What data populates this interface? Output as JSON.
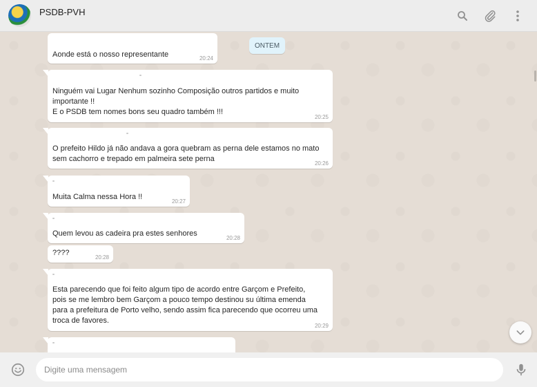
{
  "header": {
    "title": "PSDB-PVH",
    "icons": [
      "search-icon",
      "attach-icon",
      "menu-icon"
    ]
  },
  "chat": {
    "date_label": "ONTEM",
    "messages": [
      {
        "text": "Aonde está o nosso representante",
        "time": "20:24"
      },
      {
        "text": "Ninguém vai Lugar Nenhum sozinho Composição outros partidos e muito\nimportante !!\nE o PSDB tem nomes bons seu quadro também !!!",
        "time": "20:25"
      },
      {
        "text": "O prefeito Hildo já não andava a gora quebram as perna dele estamos no mato\nsem cachorro e trepado em palmeira sete perna",
        "time": "20:26"
      },
      {
        "text": "Muita Calma nessa Hora !!",
        "time": "20:27"
      },
      {
        "text": "Quem levou as cadeira pra estes senhores",
        "time": "20:28"
      },
      {
        "text": "????",
        "time": "20:28"
      },
      {
        "text": "Esta parecendo que foi feito algum tipo de acordo entre Garçom e Prefeito,\npois se me lembro bem Garçom a pouco tempo destinou su última emenda\npara a prefeitura de Porto velho, sendo assim fica parecendo que ocorreu uma\ntroca de favores.",
        "time": "20:29"
      }
    ]
  },
  "composer": {
    "placeholder": "Digite uma mensagem",
    "icons": [
      "emoji-icon",
      "microphone-icon"
    ]
  },
  "colors": {
    "background": "#e5ddd5",
    "header": "#ededed",
    "bubble": "#ffffff",
    "date_pill": "#e1f3fb",
    "icon": "#919191"
  }
}
